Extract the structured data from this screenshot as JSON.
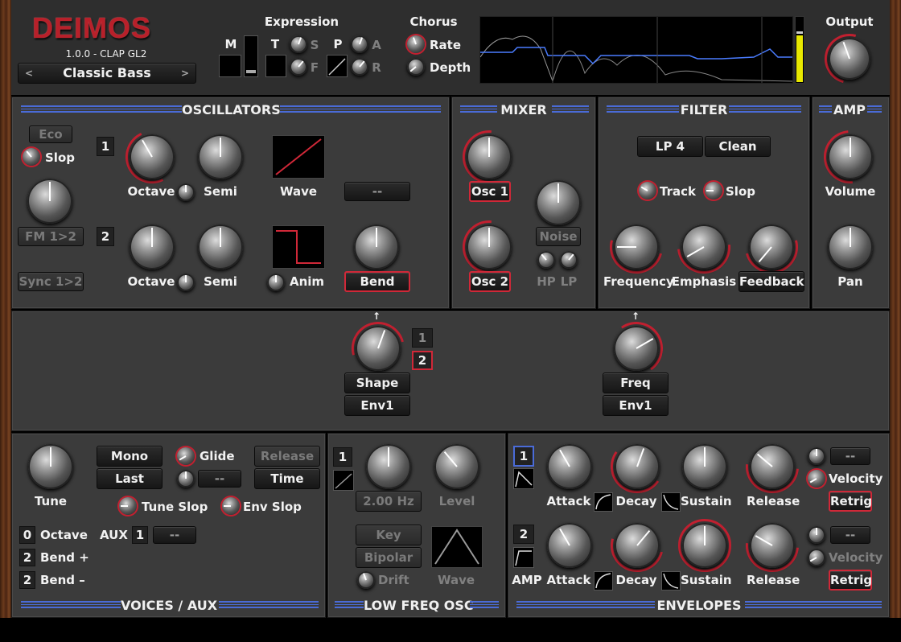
{
  "header": {
    "logo": "DEIMOS",
    "version": "1.0.0 - CLAP GL2",
    "preset": "Classic Bass",
    "preset_prev": "<",
    "preset_next": ">",
    "expression_title": "Expression",
    "m_label": "M",
    "t_label": "T",
    "s_label": "S",
    "f_label": "F",
    "p_label": "P",
    "a_label": "A",
    "r_label": "R",
    "chorus_title": "Chorus",
    "chorus_rate": "Rate",
    "chorus_depth": "Depth",
    "output_title": "Output"
  },
  "oscillators": {
    "title": "OSCILLATORS",
    "eco": "Eco",
    "slop": "Slop",
    "fm": "FM 1>2",
    "sync": "Sync 1>2",
    "osc1_num": "1",
    "osc2_num": "2",
    "octave": "Octave",
    "semi": "Semi",
    "wave": "Wave",
    "anim": "Anim",
    "bend": "Bend",
    "dash": "--"
  },
  "mixer": {
    "title": "MIXER",
    "osc1": "Osc 1",
    "osc2": "Osc 2",
    "noise": "Noise",
    "hp": "HP",
    "lp": "LP"
  },
  "filter": {
    "title": "FILTER",
    "type": "LP 4",
    "mode": "Clean",
    "track": "Track",
    "slop": "Slop",
    "frequency": "Frequency",
    "emphasis": "Emphasis",
    "feedback": "Feedback"
  },
  "amp": {
    "title": "AMP",
    "volume": "Volume",
    "pan": "Pan"
  },
  "mod": {
    "shape": "Shape",
    "env1a": "Env1",
    "freq": "Freq",
    "env1b": "Env1",
    "sel1": "1",
    "sel2": "2",
    "arrow": "↑"
  },
  "voices": {
    "title": "VOICES / AUX",
    "tune": "Tune",
    "mono": "Mono",
    "last": "Last",
    "glide": "Glide",
    "glide_val": "--",
    "release": "Release",
    "time": "Time",
    "tune_slop": "Tune Slop",
    "env_slop": "Env Slop",
    "octave_val": "0",
    "octave": "Octave",
    "aux": "AUX",
    "aux_num": "1",
    "aux_val": "--",
    "bendp_val": "2",
    "bendp": "Bend +",
    "bendm_val": "2",
    "bendm": "Bend –"
  },
  "lfo": {
    "title": "LOW FREQ OSC",
    "num": "1",
    "rate": "2.00 Hz",
    "level": "Level",
    "key": "Key",
    "bipolar": "Bipolar",
    "drift": "Drift",
    "wave": "Wave"
  },
  "envelopes": {
    "title": "ENVELOPES",
    "e1_num": "1",
    "e2_num": "2",
    "amp": "AMP",
    "attack": "Attack",
    "decay": "Decay",
    "sustain": "Sustain",
    "release": "Release",
    "velocity": "Velocity",
    "retrig": "Retrig",
    "vel_val": "--"
  },
  "colors": {
    "accent": "#c22030",
    "stripe": "#4a6bd8",
    "panel": "#3b3b3b",
    "meter": "#e8e800"
  }
}
